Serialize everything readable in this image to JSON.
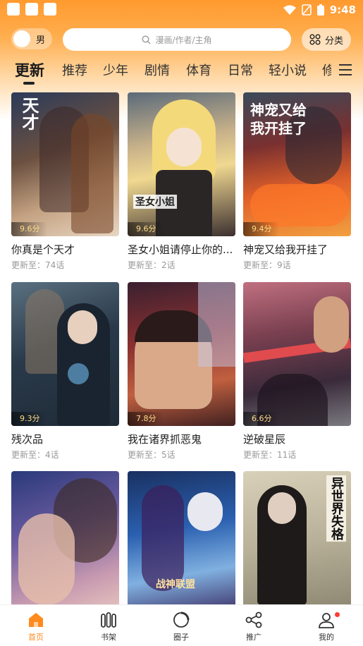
{
  "status_bar": {
    "time": "9:48"
  },
  "top_bar": {
    "gender_label": "男",
    "search_placeholder": "漫画/作者/主角",
    "category_label": "分类"
  },
  "tabs": [
    {
      "label": "更新",
      "active": true
    },
    {
      "label": "推荐"
    },
    {
      "label": "少年"
    },
    {
      "label": "剧情"
    },
    {
      "label": "体育"
    },
    {
      "label": "日常"
    },
    {
      "label": "轻小说"
    },
    {
      "label": "修"
    }
  ],
  "comics": [
    {
      "title": "你真是个天才",
      "update_prefix": "更新至：",
      "update": "74话",
      "score": "9.6分",
      "cover_text": "天才"
    },
    {
      "title": "圣女小姐请停止你的...",
      "update_prefix": "更新至：",
      "update": "2话",
      "score": "9.6分",
      "cover_text": "圣女小姐"
    },
    {
      "title": "神宠又给我开挂了",
      "update_prefix": "更新至：",
      "update": "9话",
      "score": "9.4分",
      "cover_text": "神宠又给我开挂了"
    },
    {
      "title": "残次品",
      "update_prefix": "更新至：",
      "update": "4话",
      "score": "9.3分"
    },
    {
      "title": "我在诸界抓恶鬼",
      "update_prefix": "更新至：",
      "update": "5话",
      "score": "7.8分"
    },
    {
      "title": "逆破星辰",
      "update_prefix": "更新至：",
      "update": "11话",
      "score": "6.6分"
    },
    {
      "title": "",
      "update": "",
      "score": ""
    },
    {
      "title": "",
      "update": "",
      "score": "",
      "cover_text": "战神联盟"
    },
    {
      "title": "",
      "update": "",
      "score": "",
      "cover_text": "异世界失格"
    }
  ],
  "bottom_nav": [
    {
      "label": "首页",
      "icon": "home-icon",
      "active": true
    },
    {
      "label": "书架",
      "icon": "bookshelf-icon"
    },
    {
      "label": "圈子",
      "icon": "circle-icon"
    },
    {
      "label": "推广",
      "icon": "share-icon"
    },
    {
      "label": "我的",
      "icon": "profile-icon"
    }
  ],
  "colors": {
    "accent": "#ff8a1f",
    "header": "#ff9a2f"
  }
}
